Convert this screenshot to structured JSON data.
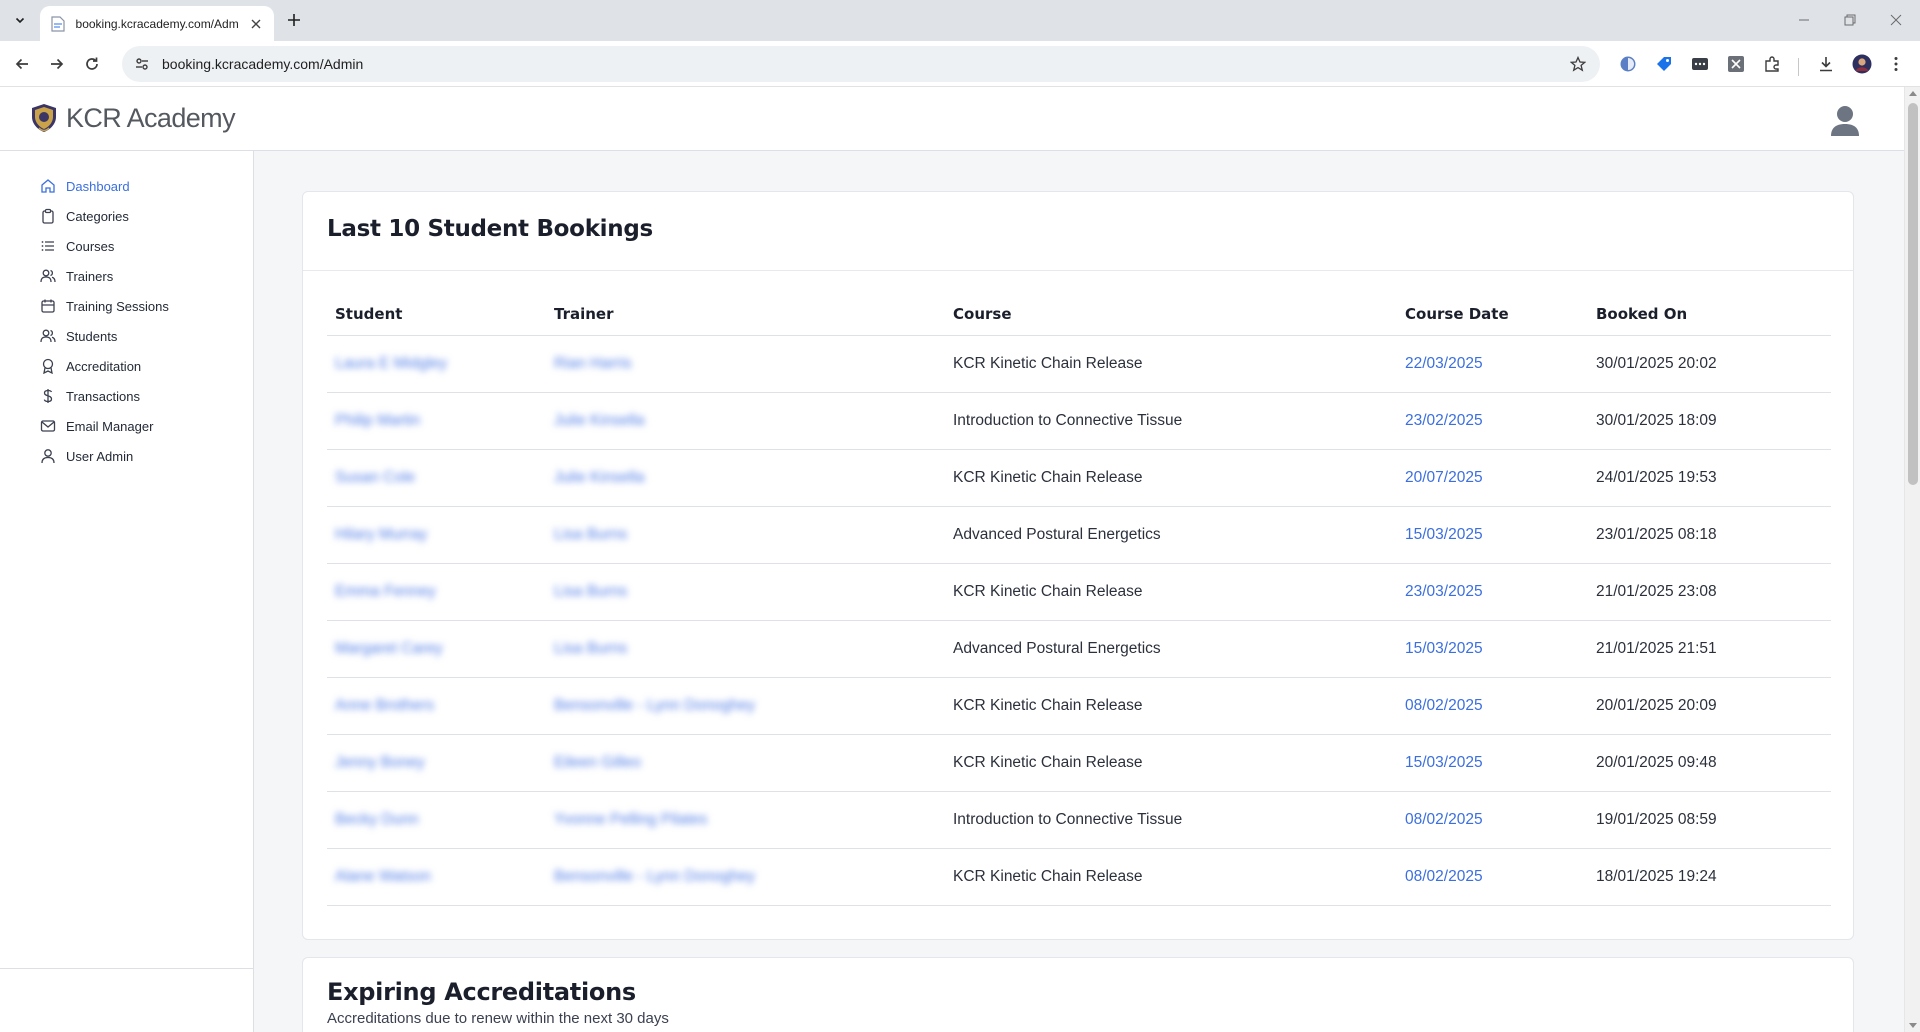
{
  "browser": {
    "tab_title": "booking.kcracademy.com/Admin",
    "url": "booking.kcracademy.com/Admin"
  },
  "app": {
    "brand": "KCR Academy"
  },
  "sidebar": {
    "items": [
      {
        "label": "Dashboard",
        "icon": "home-icon",
        "active": true
      },
      {
        "label": "Categories",
        "icon": "clipboard-icon"
      },
      {
        "label": "Courses",
        "icon": "list-icon"
      },
      {
        "label": "Trainers",
        "icon": "users-icon"
      },
      {
        "label": "Training Sessions",
        "icon": "calendar-icon"
      },
      {
        "label": "Students",
        "icon": "users-icon"
      },
      {
        "label": "Accreditation",
        "icon": "award-icon"
      },
      {
        "label": "Transactions",
        "icon": "dollar-icon"
      },
      {
        "label": "Email Manager",
        "icon": "mail-icon"
      },
      {
        "label": "User Admin",
        "icon": "user-icon"
      }
    ]
  },
  "bookings": {
    "title": "Last 10 Student Bookings",
    "columns": [
      "Student",
      "Trainer",
      "Course",
      "Course Date",
      "Booked On"
    ],
    "rows": [
      {
        "student": "Laura E Midgley",
        "trainer": "Rian Harris",
        "course": "KCR Kinetic Chain Release",
        "course_date": "22/03/2025",
        "booked_on": "30/01/2025 20:02"
      },
      {
        "student": "Philip Martin",
        "trainer": "Julie Kinsella",
        "course": "Introduction to Connective Tissue",
        "course_date": "23/02/2025",
        "booked_on": "30/01/2025 18:09"
      },
      {
        "student": "Susan Cole",
        "trainer": "Julie Kinsella",
        "course": "KCR Kinetic Chain Release",
        "course_date": "20/07/2025",
        "booked_on": "24/01/2025 19:53"
      },
      {
        "student": "Hilary Murray",
        "trainer": "Lisa Burns",
        "course": "Advanced Postural Energetics",
        "course_date": "15/03/2025",
        "booked_on": "23/01/2025 08:18"
      },
      {
        "student": "Emma Fenney",
        "trainer": "Lisa Burns",
        "course": "KCR Kinetic Chain Release",
        "course_date": "23/03/2025",
        "booked_on": "21/01/2025 23:08"
      },
      {
        "student": "Margaret Carey",
        "trainer": "Lisa Burns",
        "course": "Advanced Postural Energetics",
        "course_date": "15/03/2025",
        "booked_on": "21/01/2025 21:51"
      },
      {
        "student": "Anne Brothers",
        "trainer": "Bensonville - Lynn Donoghey",
        "course": "KCR Kinetic Chain Release",
        "course_date": "08/02/2025",
        "booked_on": "20/01/2025 20:09"
      },
      {
        "student": "Jenny Boney",
        "trainer": "Eileen Gilleo",
        "course": "KCR Kinetic Chain Release",
        "course_date": "15/03/2025",
        "booked_on": "20/01/2025 09:48"
      },
      {
        "student": "Becky Dunn",
        "trainer": "Yvonne Pelling Pilates",
        "course": "Introduction to Connective Tissue",
        "course_date": "08/02/2025",
        "booked_on": "19/01/2025 08:59"
      },
      {
        "student": "Alane Watson",
        "trainer": "Bensonville - Lynn Donoghey",
        "course": "KCR Kinetic Chain Release",
        "course_date": "08/02/2025",
        "booked_on": "18/01/2025 19:24"
      }
    ]
  },
  "accreditations": {
    "title": "Expiring Accreditations",
    "subtitle": "Accreditations due to renew within the next 30 days"
  },
  "colors": {
    "accent": "#3b6fe0",
    "page_bg": "#f4f6f8",
    "border": "#dee2e6"
  }
}
